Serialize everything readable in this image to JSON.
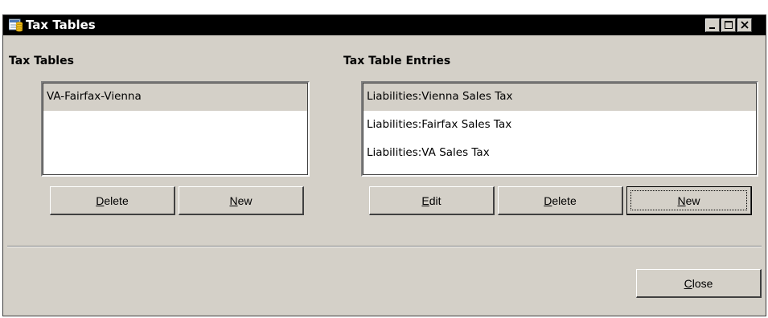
{
  "window": {
    "title": "Tax Tables",
    "icon": "tax-table-app-icon",
    "controls": {
      "minimize": "minimize-icon",
      "maximize": "maximize-icon",
      "close": "close-icon"
    }
  },
  "tax_tables": {
    "label": "Tax Tables",
    "items": [
      "VA-Fairfax-Vienna"
    ],
    "selected_index": 0,
    "buttons": {
      "delete": {
        "mnemonic": "D",
        "rest": "elete"
      },
      "new": {
        "mnemonic": "N",
        "rest": "ew"
      }
    }
  },
  "tax_table_entries": {
    "label": "Tax Table Entries",
    "items": [
      "Liabilities:Vienna Sales Tax",
      "Liabilities:Fairfax Sales Tax",
      "Liabilities:VA Sales Tax"
    ],
    "selected_index": 0,
    "buttons": {
      "edit": {
        "mnemonic": "E",
        "rest": "dit"
      },
      "delete": {
        "mnemonic": "D",
        "rest": "elete"
      },
      "new": {
        "mnemonic": "N",
        "rest": "ew"
      }
    }
  },
  "footer": {
    "close": {
      "mnemonic": "C",
      "rest": "lose"
    }
  },
  "colors": {
    "face": "#d4d0c8",
    "titlebar": "#000000",
    "selection": "#d4d0c8"
  }
}
